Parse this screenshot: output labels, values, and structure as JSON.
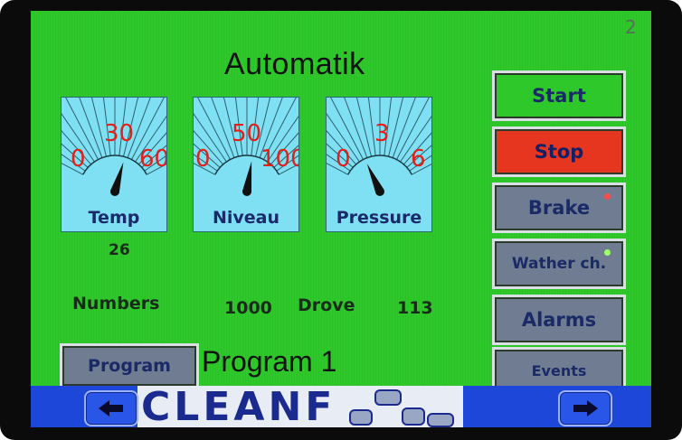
{
  "screen": {
    "page_number": "2",
    "title": "Automatik"
  },
  "gauges": [
    {
      "label": "Temp",
      "scale": [
        "0",
        "30",
        "60"
      ],
      "needle_fraction": 0.63
    },
    {
      "label": "Niveau",
      "scale": [
        "0",
        "50",
        "100"
      ],
      "needle_fraction": 0.57
    },
    {
      "label": "Pressure",
      "scale": [
        "0",
        "3",
        "6"
      ],
      "needle_fraction": 0.3
    }
  ],
  "readouts": {
    "temp_value": "26",
    "numbers_label": "Numbers",
    "numbers_value": "1000",
    "drove_label": "Drove",
    "drove_value": "113"
  },
  "program": {
    "button_label": "Program",
    "name": "Program 1"
  },
  "side_buttons": {
    "start": "Start",
    "stop": "Stop",
    "brake": "Brake",
    "wather": "Wather ch.",
    "alarms": "Alarms",
    "events": "Events"
  },
  "indicators": {
    "brake_color": "#ff4d4d",
    "wather_color": "#9dff6a"
  },
  "colors": {
    "screen_bg": "#2ec82a",
    "stop_bg": "#e6361f",
    "gauge_bg": "#7fe0f4",
    "button_grey": "#6f7c92",
    "bar_blue": "#1d47d9"
  },
  "footer": {
    "logo_text": "CLEANF",
    "left_icon": "arrow-left-icon",
    "right_icon": "arrow-right-icon"
  }
}
